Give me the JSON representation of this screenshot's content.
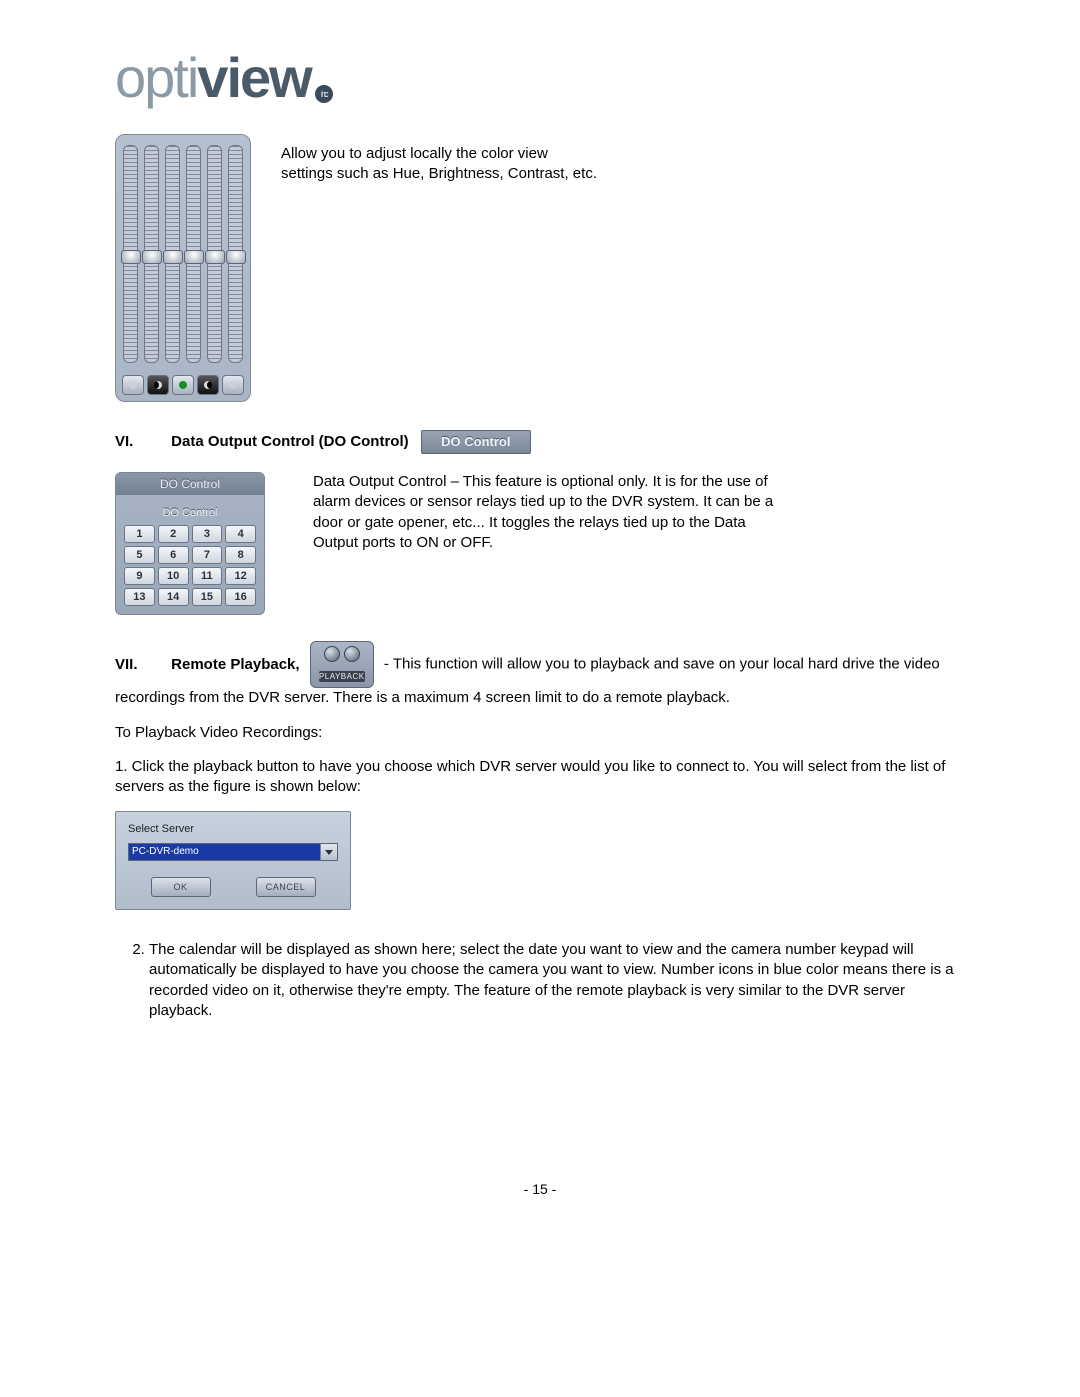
{
  "logo": {
    "part1": "opti",
    "part2": "view",
    "inc": "inc"
  },
  "section5": {
    "text": "Allow you to adjust locally the color view settings such as Hue, Brightness, Contrast, etc.",
    "slider_positions_pct": [
      48,
      48,
      48,
      48,
      48,
      48
    ],
    "mini_buttons": [
      "sun-icon",
      "moon-icon",
      "contrast-icon",
      "half-moon-icon",
      "dot-icon"
    ]
  },
  "section6": {
    "numeral": "VI.",
    "title": "Data Output Control (DO Control)",
    "badge": "DO Control",
    "panel_header": "DO Control",
    "panel_subheader": "DO Control",
    "keys": [
      "1",
      "2",
      "3",
      "4",
      "5",
      "6",
      "7",
      "8",
      "9",
      "10",
      "11",
      "12",
      "13",
      "14",
      "15",
      "16"
    ],
    "text": "Data Output Control – This feature is optional only. It is for the use of alarm devices or sensor relays tied up to the DVR system. It can be a door or gate opener, etc... It toggles the relays tied up to the Data Output ports to ON or OFF."
  },
  "section7": {
    "numeral": "VII.",
    "title": "Remote Playback,",
    "playback_label": "PLAYBACK",
    "text_after": " - This function will allow you to playback and save on your local hard drive the video recordings from the DVR server. There is a maximum 4 screen limit to do a remote playback.",
    "instructions_title": "To Playback Video Recordings:",
    "step1": "1. Click the playback button to have you choose which DVR server would you like to connect to. You will select from the list of servers as the figure is shown below:",
    "dialog": {
      "title": "Select Server",
      "value": "PC-DVR-demo",
      "ok": "OK",
      "cancel": "CANCEL"
    },
    "step2": "The calendar will be displayed as shown here; select the date you want to view and the camera number keypad will automatically be displayed to have you choose the camera you want to view. Number icons in blue color means there is a recorded video on it, otherwise they're empty. The feature of the remote playback is very similar to the DVR server playback."
  },
  "page_number": "- 15 -"
}
